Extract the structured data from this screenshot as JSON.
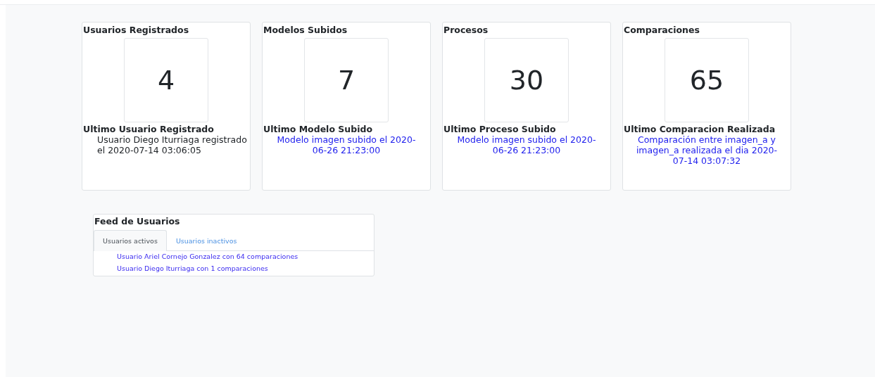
{
  "cards": [
    {
      "title": "Usuarios Registrados",
      "count": "4",
      "latest_label": "Ultimo Usuario Registrado",
      "latest_text": "Usuario Diego Iturriaga registrado el 2020-07-14 03:06:05",
      "link": false
    },
    {
      "title": "Modelos Subidos",
      "count": "7",
      "latest_label": "Ultimo Modelo Subido",
      "latest_text": "Modelo imagen subido el 2020-06-26 21:23:00",
      "link": true
    },
    {
      "title": "Procesos",
      "count": "30",
      "latest_label": "Ultimo Proceso Subido",
      "latest_text": "Modelo imagen subido el 2020-06-26 21:23:00",
      "link": true
    },
    {
      "title": "Comparaciones",
      "count": "65",
      "latest_label": "Ultimo Comparacion Realizada",
      "latest_text": "Comparación entre imagen_a y imagen_a realizada el dia 2020-07-14 03:07:32",
      "link": true
    }
  ],
  "feed": {
    "title": "Feed de Usuarios",
    "tabs": [
      {
        "label": "Usuarios activos",
        "selected": true
      },
      {
        "label": "Usuarios inactivos",
        "selected": false
      }
    ],
    "items": [
      "Usuario Ariel Cornejo Gonzalez con 64 comparaciones",
      "Usuario Diego Iturriaga con 1 comparaciones"
    ]
  }
}
